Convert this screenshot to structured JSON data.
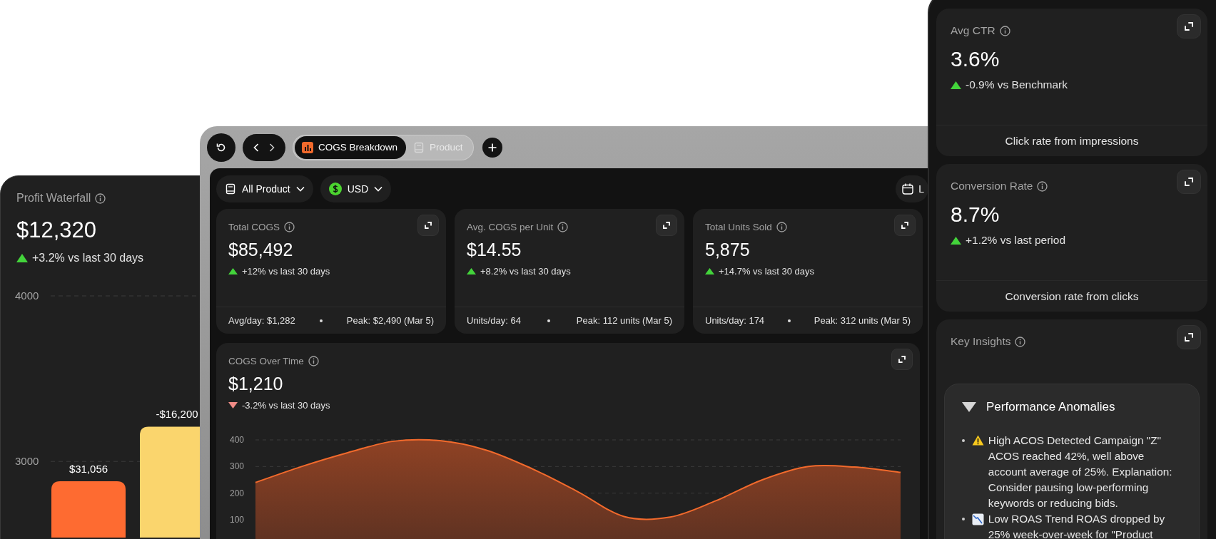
{
  "waterfall_panel": {
    "title": "Profit Waterfall",
    "value": "$12,320",
    "delta": {
      "kind": "up",
      "text": "+3.2% vs last 30 days"
    },
    "chart_data": {
      "type": "bar",
      "grid": true,
      "ylim": [
        2540,
        4000
      ],
      "yticks": [
        3000,
        4000
      ],
      "value_labels": [
        "$31,056",
        "-$16,200"
      ],
      "series": [
        {
          "values": [
            2880,
            3210
          ]
        }
      ]
    }
  },
  "browser": {
    "tabs": [
      {
        "label": "COGS Breakdown",
        "selected": true
      },
      {
        "label": "Product",
        "selected": false
      }
    ],
    "filters": [
      {
        "kind": "dropdown",
        "label": "All Product"
      },
      {
        "kind": "dropdown",
        "label": "USD"
      },
      {
        "kind": "date",
        "label": "L"
      }
    ],
    "stat_cards": [
      {
        "title": "Total COGS",
        "value": "$85,492",
        "delta": {
          "kind": "up",
          "text": "+12% vs last 30 days"
        },
        "footer": [
          "Avg/day: $1,282",
          "Peak: $2,490 (Mar 5)"
        ]
      },
      {
        "title": "Avg. COGS per Unit",
        "value": "$14.55",
        "delta": {
          "kind": "up",
          "text": "+8.2% vs last 30 days"
        },
        "footer": [
          "Units/day: 64",
          "Peak: 112 units (Mar 5)"
        ]
      },
      {
        "title": "Total Units Sold",
        "value": "5,875",
        "delta": {
          "kind": "up",
          "text": "+14.7% vs last 30 days"
        },
        "footer": [
          "Units/day: 174",
          "Peak: 312 units (Mar 5)"
        ]
      }
    ],
    "chart_card": {
      "title": "COGS Over Time",
      "value": "$1,210",
      "delta": {
        "kind": "down",
        "text": "-3.2% vs last 30 days"
      },
      "chart_data": {
        "type": "area",
        "grid": true,
        "ylim": [
          100,
          400
        ],
        "yticks": [
          100,
          200,
          300,
          400
        ],
        "series": [
          {
            "color": "#f26a2c",
            "values": [
              240,
              300,
              352,
              395,
              397,
              362,
              292,
              205,
              112,
              110,
              172,
              250,
              300,
              298,
              278
            ]
          }
        ]
      }
    }
  },
  "right_panel": {
    "metric_cards": [
      {
        "title": "Avg CTR",
        "value": "3.6%",
        "delta": {
          "kind": "up",
          "text": "-0.9% vs Benchmark"
        },
        "footer": "Click rate from impressions"
      },
      {
        "title": "Conversion Rate",
        "value": "8.7%",
        "delta": {
          "kind": "up",
          "text": "+1.2% vs last period"
        },
        "footer": "Conversion rate from clicks"
      }
    ],
    "insights": {
      "title": "Key Insights",
      "section": {
        "title": "Performance Anomalies",
        "expanded": true,
        "items": [
          {
            "text": "High ACOS Detected Campaign \"Z\" ACOS reached 42%, well above account average of 25%. Explanation: Consider pausing low-performing keywords or reducing bids."
          },
          {
            "text": "Low ROAS Trend ROAS dropped by 25% week-over-week for \"Product"
          }
        ]
      }
    }
  }
}
